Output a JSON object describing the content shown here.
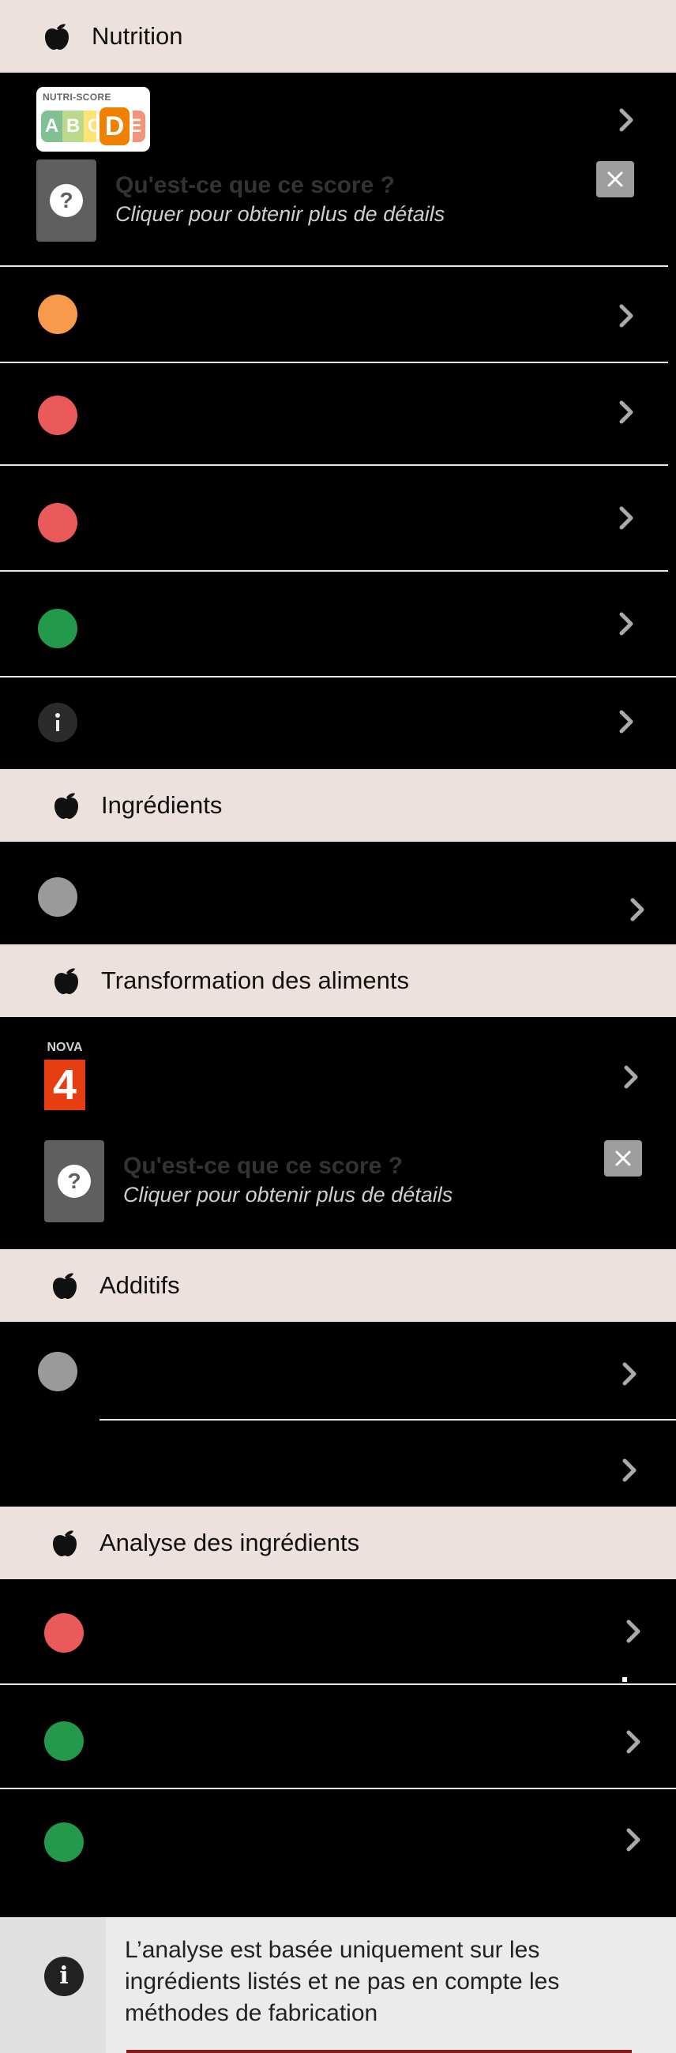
{
  "sections": {
    "nutrition": {
      "title": "Nutrition",
      "nutri_score": {
        "label": "NUTRI-SCORE",
        "grades": [
          "A",
          "B",
          "C",
          "D",
          "E"
        ],
        "selected": "D"
      }
    },
    "ingredients": {
      "title": "Ingrédients"
    },
    "processing": {
      "title": "Transformation des aliments",
      "nova": {
        "label": "NOVA",
        "group": "4"
      }
    },
    "additives": {
      "title": "Additifs"
    },
    "analysis": {
      "title": "Analyse des ingrédients"
    }
  },
  "help_card": {
    "question": "Qu'est-ce que ce score ?",
    "subtitle": "Cliquer pour obtenir plus de détails"
  },
  "info_note": {
    "text": "L’analyse est basée uniquement sur les ingrédients listés et ne pas en compte les méthodes de fabrication"
  },
  "icons": {
    "section": "apple-icon",
    "chevron": "chevron-right-icon",
    "close": "close-icon",
    "help": "question-icon",
    "info": "info-icon"
  },
  "colors": {
    "header_bg": "#ede1dd",
    "orange": "#f79a4c",
    "red": "#ea5a5a",
    "green": "#239a4b",
    "grey": "#9a9a9a",
    "nova_red": "#e63e11"
  }
}
